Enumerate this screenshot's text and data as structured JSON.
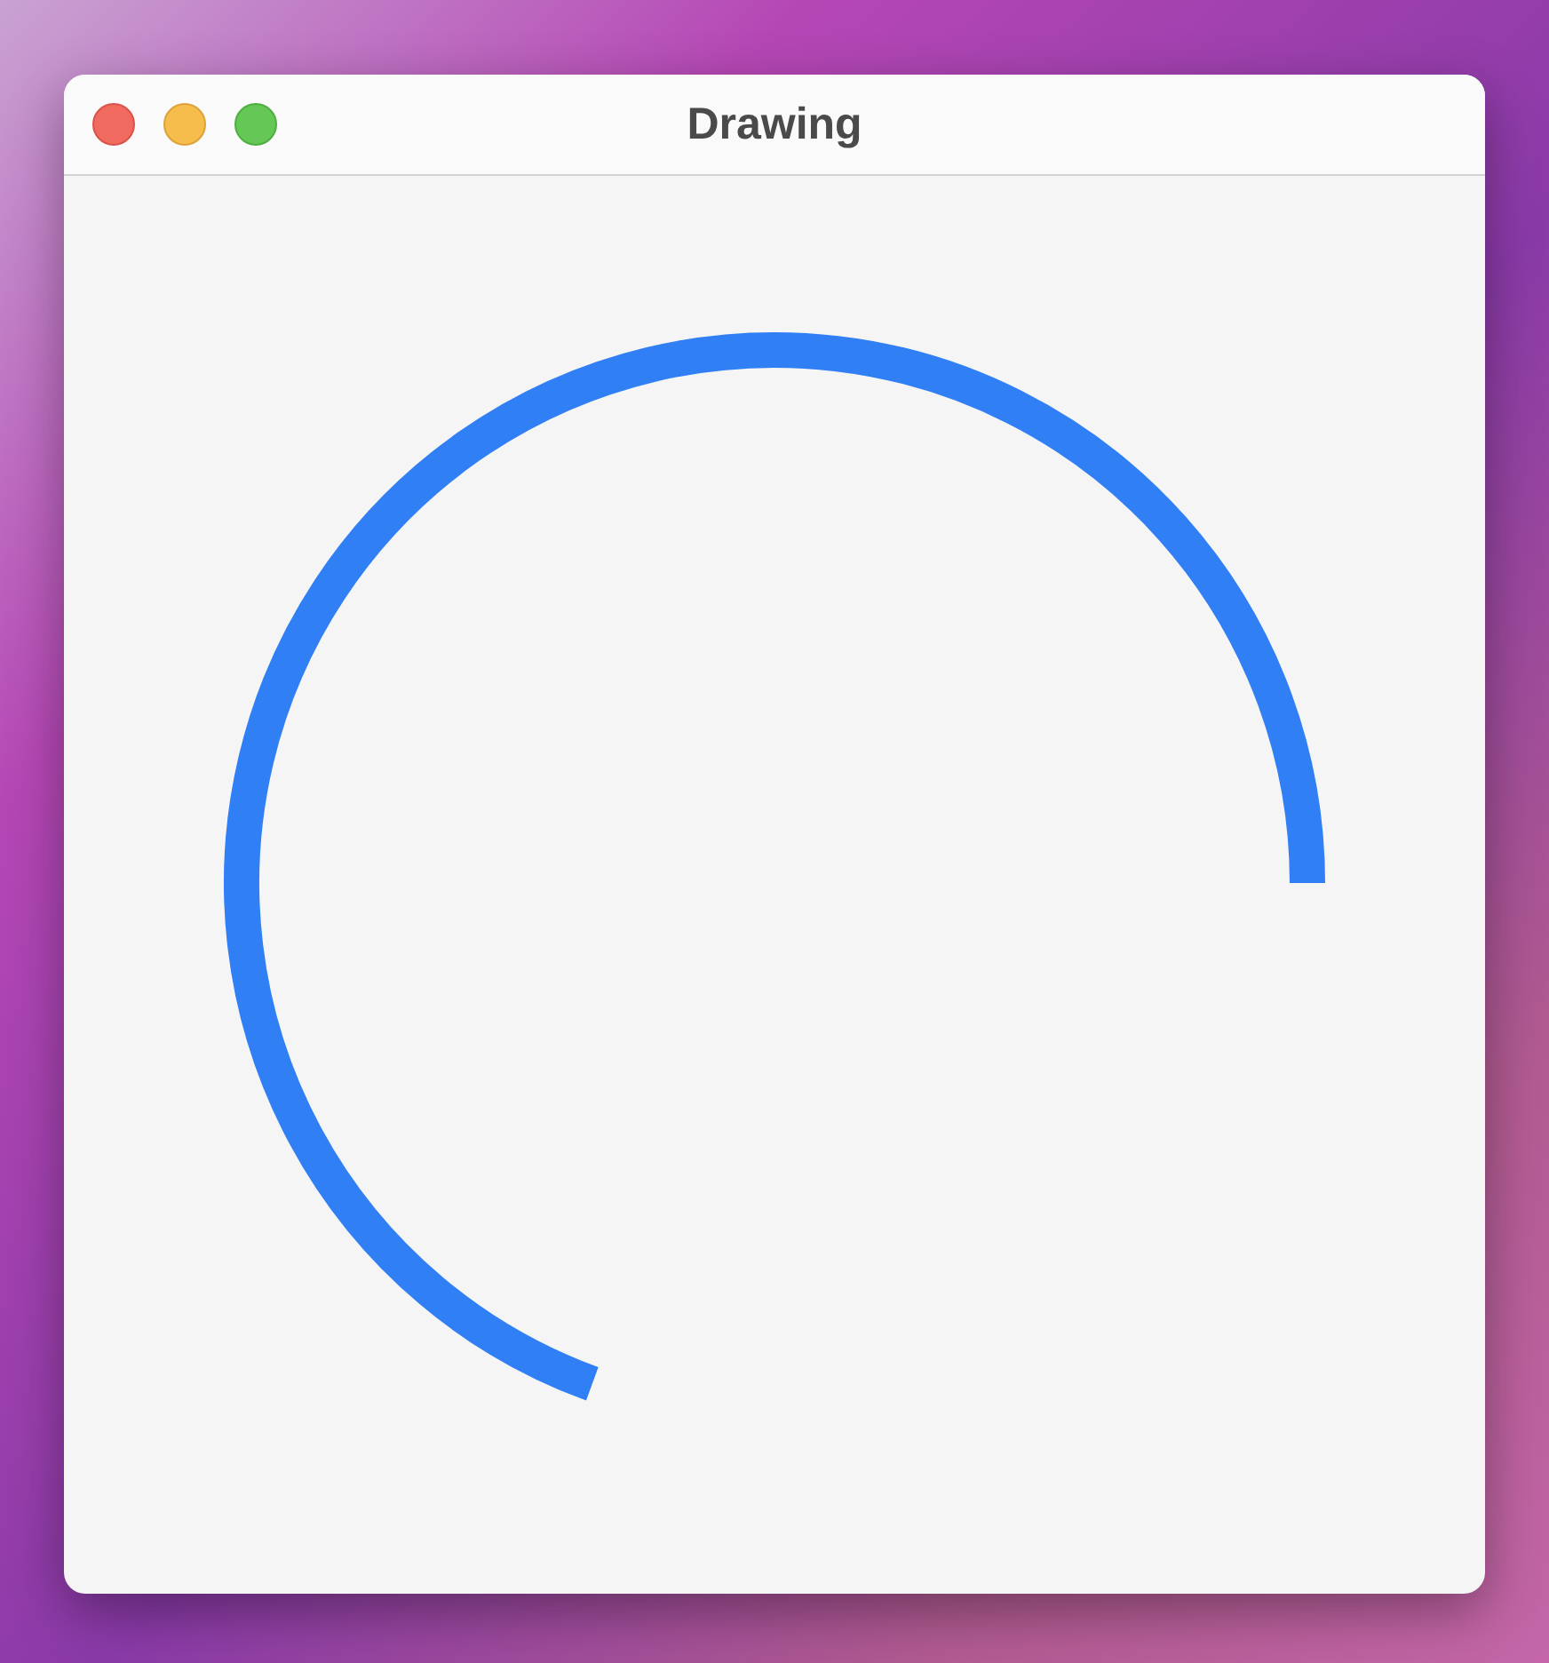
{
  "window": {
    "title": "Drawing"
  }
}
